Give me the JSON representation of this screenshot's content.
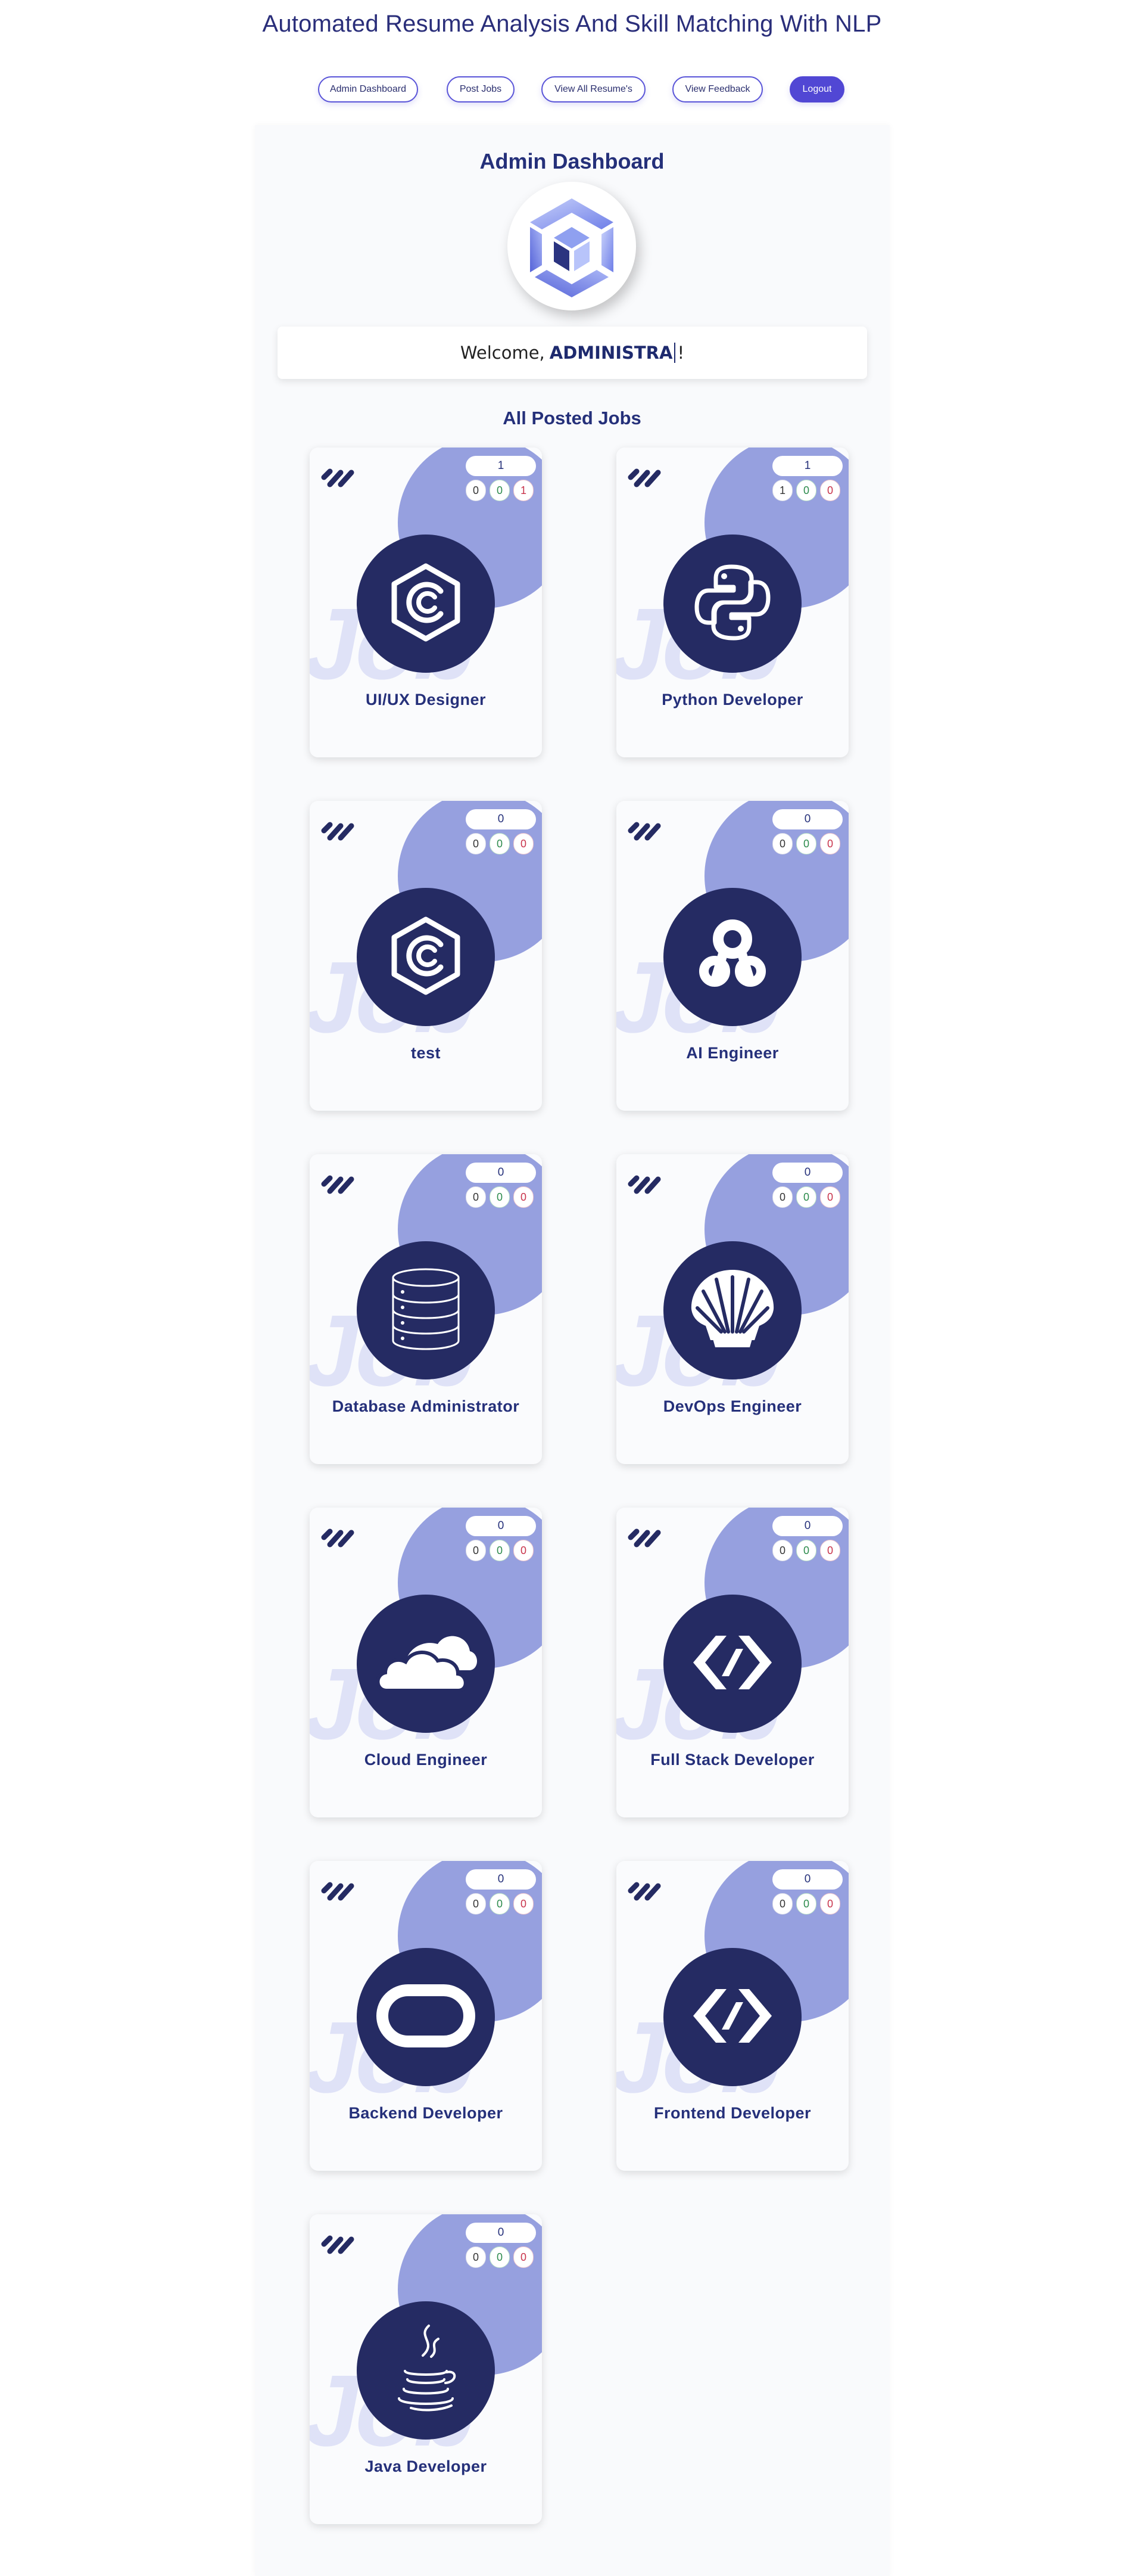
{
  "header": {
    "title": "Automated Resume Analysis And Skill Matching With NLP"
  },
  "nav": [
    {
      "label": "Admin Dashboard",
      "active": false
    },
    {
      "label": "Post Jobs",
      "active": false
    },
    {
      "label": "View All Resume's",
      "active": false
    },
    {
      "label": "View Feedback",
      "active": false
    },
    {
      "label": "Logout",
      "active": true
    }
  ],
  "dashboard": {
    "title": "Admin Dashboard",
    "welcome_prefix": "Welcome,",
    "user_name": "ADMINISTRA",
    "welcome_suffix": "!",
    "jobs_heading": "All Posted Jobs"
  },
  "job_card_watermark": "Job",
  "jobs": [
    {
      "title": "UI/UX Designer",
      "total": "1",
      "counts": [
        "0",
        "0",
        "1"
      ],
      "icon": "c-hexagon-icon"
    },
    {
      "title": "Python Developer",
      "total": "1",
      "counts": [
        "1",
        "0",
        "0"
      ],
      "icon": "python-icon"
    },
    {
      "title": "test",
      "total": "0",
      "counts": [
        "0",
        "0",
        "0"
      ],
      "icon": "c-hexagon-icon"
    },
    {
      "title": "AI Engineer",
      "total": "0",
      "counts": [
        "0",
        "0",
        "0"
      ],
      "icon": "openai-knot-icon"
    },
    {
      "title": "Database Administrator",
      "total": "0",
      "counts": [
        "0",
        "0",
        "0"
      ],
      "icon": "database-icon"
    },
    {
      "title": "DevOps Engineer",
      "total": "0",
      "counts": [
        "0",
        "0",
        "0"
      ],
      "icon": "shell-icon"
    },
    {
      "title": "Cloud Engineer",
      "total": "0",
      "counts": [
        "0",
        "0",
        "0"
      ],
      "icon": "cloud-icon"
    },
    {
      "title": "Full Stack Developer",
      "total": "0",
      "counts": [
        "0",
        "0",
        "0"
      ],
      "icon": "code-brackets-icon"
    },
    {
      "title": "Backend Developer",
      "total": "0",
      "counts": [
        "0",
        "0",
        "0"
      ],
      "icon": "oracle-icon"
    },
    {
      "title": "Frontend Developer",
      "total": "0",
      "counts": [
        "0",
        "0",
        "0"
      ],
      "icon": "code-brackets-icon"
    },
    {
      "title": "Java Developer",
      "total": "0",
      "counts": [
        "0",
        "0",
        "0"
      ],
      "icon": "java-icon"
    }
  ],
  "colors": {
    "accent": "#5147d4",
    "title": "#25307a",
    "icon_circle": "#252b63",
    "blob": "#96a0df"
  }
}
